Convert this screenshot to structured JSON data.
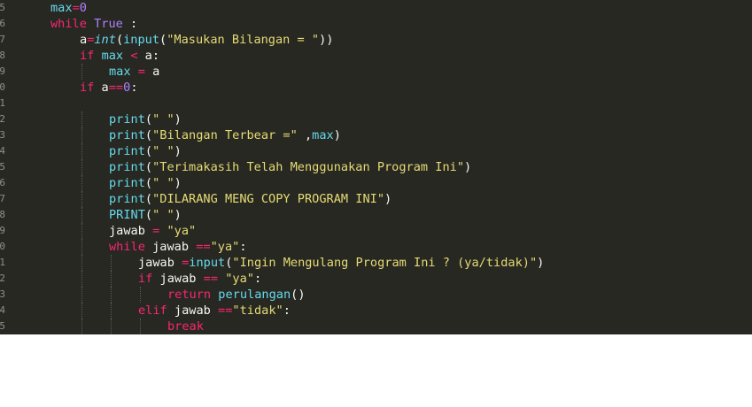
{
  "colors": {
    "background": "#272822",
    "default": "#f8f8f2",
    "keyword": "#f92672",
    "function": "#66d9ef",
    "string": "#e6db74",
    "number": "#ae81ff",
    "builtin_italic": "#66d9ef",
    "line_number": "#8f908a"
  },
  "editor": {
    "line_numbers": [
      "5",
      "6",
      "7",
      "8",
      "9",
      "0",
      "1",
      "2",
      "3",
      "4",
      "5",
      "6",
      "7",
      "8",
      "9",
      "0",
      "1",
      "2",
      "3",
      "4",
      "5",
      "6"
    ],
    "lines": [
      {
        "indent": 1,
        "tokens": [
          {
            "t": "max",
            "c": "function"
          },
          {
            "t": "=",
            "c": "keyword"
          },
          {
            "t": "0",
            "c": "number"
          }
        ]
      },
      {
        "indent": 1,
        "tokens": [
          {
            "t": "while",
            "c": "keyword"
          },
          {
            "t": " ",
            "c": "default"
          },
          {
            "t": "True",
            "c": "number"
          },
          {
            "t": " :",
            "c": "default"
          }
        ]
      },
      {
        "indent": 2,
        "tokens": [
          {
            "t": "a",
            "c": "default"
          },
          {
            "t": "=",
            "c": "keyword"
          },
          {
            "t": "int",
            "c": "builtin_italic",
            "i": true
          },
          {
            "t": "(",
            "c": "default"
          },
          {
            "t": "input",
            "c": "function"
          },
          {
            "t": "(",
            "c": "default"
          },
          {
            "t": "\"Masukan Bilangan = \"",
            "c": "string"
          },
          {
            "t": "))",
            "c": "default"
          }
        ]
      },
      {
        "indent": 2,
        "tokens": [
          {
            "t": "if",
            "c": "keyword"
          },
          {
            "t": " ",
            "c": "default"
          },
          {
            "t": "max",
            "c": "function"
          },
          {
            "t": " ",
            "c": "default"
          },
          {
            "t": "<",
            "c": "keyword"
          },
          {
            "t": " a:",
            "c": "default"
          }
        ]
      },
      {
        "indent": 3,
        "tokens": [
          {
            "t": "max",
            "c": "function"
          },
          {
            "t": " ",
            "c": "default"
          },
          {
            "t": "=",
            "c": "keyword"
          },
          {
            "t": " a",
            "c": "default"
          }
        ]
      },
      {
        "indent": 2,
        "tokens": [
          {
            "t": "if",
            "c": "keyword"
          },
          {
            "t": " a",
            "c": "default"
          },
          {
            "t": "==",
            "c": "keyword"
          },
          {
            "t": "0",
            "c": "number"
          },
          {
            "t": ":",
            "c": "default"
          }
        ]
      },
      {
        "indent": 0,
        "tokens": []
      },
      {
        "indent": 3,
        "tokens": [
          {
            "t": "print",
            "c": "function"
          },
          {
            "t": "(",
            "c": "default"
          },
          {
            "t": "\" \"",
            "c": "string"
          },
          {
            "t": ")",
            "c": "default"
          }
        ]
      },
      {
        "indent": 3,
        "tokens": [
          {
            "t": "print",
            "c": "function"
          },
          {
            "t": "(",
            "c": "default"
          },
          {
            "t": "\"Bilangan Terbear =\"",
            "c": "string"
          },
          {
            "t": " ,",
            "c": "default"
          },
          {
            "t": "max",
            "c": "function"
          },
          {
            "t": ")",
            "c": "default"
          }
        ]
      },
      {
        "indent": 3,
        "tokens": [
          {
            "t": "print",
            "c": "function"
          },
          {
            "t": "(",
            "c": "default"
          },
          {
            "t": "\" \"",
            "c": "string"
          },
          {
            "t": ")",
            "c": "default"
          }
        ]
      },
      {
        "indent": 3,
        "tokens": [
          {
            "t": "print",
            "c": "function"
          },
          {
            "t": "(",
            "c": "default"
          },
          {
            "t": "\"Terimakasih Telah Menggunakan Program Ini\"",
            "c": "string"
          },
          {
            "t": ")",
            "c": "default"
          }
        ]
      },
      {
        "indent": 3,
        "tokens": [
          {
            "t": "print",
            "c": "function"
          },
          {
            "t": "(",
            "c": "default"
          },
          {
            "t": "\" \"",
            "c": "string"
          },
          {
            "t": ")",
            "c": "default"
          }
        ]
      },
      {
        "indent": 3,
        "tokens": [
          {
            "t": "print",
            "c": "function"
          },
          {
            "t": "(",
            "c": "default"
          },
          {
            "t": "\"DILARANG MENG COPY PROGRAM INI\"",
            "c": "string"
          },
          {
            "t": ")",
            "c": "default"
          }
        ]
      },
      {
        "indent": 3,
        "tokens": [
          {
            "t": "PRINT",
            "c": "function"
          },
          {
            "t": "(",
            "c": "default"
          },
          {
            "t": "\" \"",
            "c": "string"
          },
          {
            "t": ")",
            "c": "default"
          }
        ]
      },
      {
        "indent": 3,
        "tokens": [
          {
            "t": "jawab",
            "c": "default"
          },
          {
            "t": " ",
            "c": "default"
          },
          {
            "t": "=",
            "c": "keyword"
          },
          {
            "t": " ",
            "c": "default"
          },
          {
            "t": "\"ya\"",
            "c": "string"
          }
        ]
      },
      {
        "indent": 3,
        "tokens": [
          {
            "t": "while",
            "c": "keyword"
          },
          {
            "t": " jawab ",
            "c": "default"
          },
          {
            "t": "==",
            "c": "keyword"
          },
          {
            "t": "\"ya\"",
            "c": "string"
          },
          {
            "t": ":",
            "c": "default"
          }
        ]
      },
      {
        "indent": 4,
        "tokens": [
          {
            "t": "jawab ",
            "c": "default"
          },
          {
            "t": "=",
            "c": "keyword"
          },
          {
            "t": "input",
            "c": "function"
          },
          {
            "t": "(",
            "c": "default"
          },
          {
            "t": "\"Ingin Mengulang Program Ini ? (ya/tidak)\"",
            "c": "string"
          },
          {
            "t": ")",
            "c": "default"
          }
        ]
      },
      {
        "indent": 4,
        "tokens": [
          {
            "t": "if",
            "c": "keyword"
          },
          {
            "t": " jawab ",
            "c": "default"
          },
          {
            "t": "==",
            "c": "keyword"
          },
          {
            "t": " ",
            "c": "default"
          },
          {
            "t": "\"ya\"",
            "c": "string"
          },
          {
            "t": ":",
            "c": "default"
          }
        ]
      },
      {
        "indent": 5,
        "tokens": [
          {
            "t": "return",
            "c": "keyword"
          },
          {
            "t": " ",
            "c": "default"
          },
          {
            "t": "perulangan",
            "c": "function"
          },
          {
            "t": "()",
            "c": "default"
          }
        ]
      },
      {
        "indent": 4,
        "tokens": [
          {
            "t": "elif",
            "c": "keyword"
          },
          {
            "t": " jawab ",
            "c": "default"
          },
          {
            "t": "==",
            "c": "keyword"
          },
          {
            "t": "\"tidak\"",
            "c": "string"
          },
          {
            "t": ":",
            "c": "default"
          }
        ]
      },
      {
        "indent": 5,
        "tokens": [
          {
            "t": "break",
            "c": "keyword"
          }
        ]
      }
    ]
  }
}
